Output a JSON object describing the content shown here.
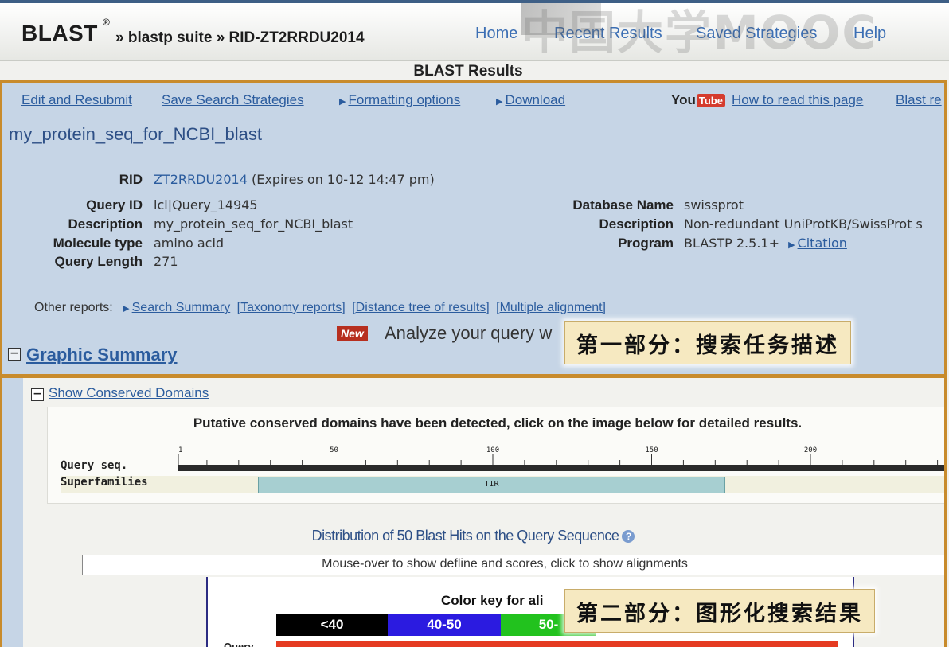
{
  "header": {
    "logo": "BLAST",
    "reg_mark": "®",
    "breadcrumb": "» blastp suite » RID-ZT2RRDU2014",
    "nav": [
      "Home",
      "Recent Results",
      "Saved Strategies",
      "Help"
    ],
    "watermark": "中国大学MOOC"
  },
  "results_title": "BLAST Results",
  "toolbar": {
    "edit_resubmit": "Edit and Resubmit",
    "save_strategies": "Save Search Strategies",
    "formatting_options": "Formatting options",
    "download": "Download",
    "youtube_you": "You",
    "youtube_tube": "Tube",
    "how_to_read": "How to read this page",
    "blast_re": "Blast re"
  },
  "job_title": "my_protein_seq_for_NCBI_blast",
  "summary": {
    "rid_label": "RID",
    "rid_value": "ZT2RRDU2014",
    "rid_expires": "(Expires on 10-12 14:47 pm)",
    "query_id_label": "Query ID",
    "query_id_value": "lcl|Query_14945",
    "description_label": "Description",
    "description_value": "my_protein_seq_for_NCBI_blast",
    "molecule_type_label": "Molecule type",
    "molecule_type_value": "amino acid",
    "query_length_label": "Query Length",
    "query_length_value": "271",
    "db_name_label": "Database Name",
    "db_name_value": "swissprot",
    "db_description_label": "Description",
    "db_description_value": "Non-redundant UniProtKB/SwissProt s",
    "program_label": "Program",
    "program_value": "BLASTP 2.5.1+",
    "citation": "Citation"
  },
  "other_reports": {
    "label": "Other reports:",
    "search_summary": "Search Summary",
    "taxonomy": "[Taxonomy reports]",
    "distance_tree": "[Distance tree of results]",
    "multiple_alignment": "[Multiple alignment]"
  },
  "analyze": {
    "badge": "New",
    "text": "Analyze your query w"
  },
  "graphic_summary": {
    "toggle": "−",
    "title": "Graphic Summary"
  },
  "callouts": {
    "part1": "第一部分：搜索任务描述",
    "part2": "第二部分：图形化搜索结果"
  },
  "conserved": {
    "toggle": "−",
    "title": "Show Conserved Domains",
    "message": "Putative conserved domains have been detected, click on the image below for detailed results.",
    "query_seq_label": "Query seq.",
    "superfamilies_label": "Superfamilies",
    "domain_name": "TIR",
    "ruler_ticks": [
      "1",
      "50",
      "100",
      "150",
      "200"
    ],
    "domain_start": 27,
    "domain_end": 174,
    "query_length": 271
  },
  "distribution": {
    "title": "Distribution of 50 Blast Hits on the Query Sequence",
    "help_icon": "?",
    "mouse_msg": "Mouse-over to show defline and scores, click to show alignments",
    "color_key_title": "Color key for ali",
    "color_key": [
      {
        "label": "<40",
        "color": "#000000"
      },
      {
        "label": "40-50",
        "color": "#2b1be0"
      },
      {
        "label": "50-",
        "color": "#22c21e"
      }
    ],
    "query_label": "Query"
  }
}
